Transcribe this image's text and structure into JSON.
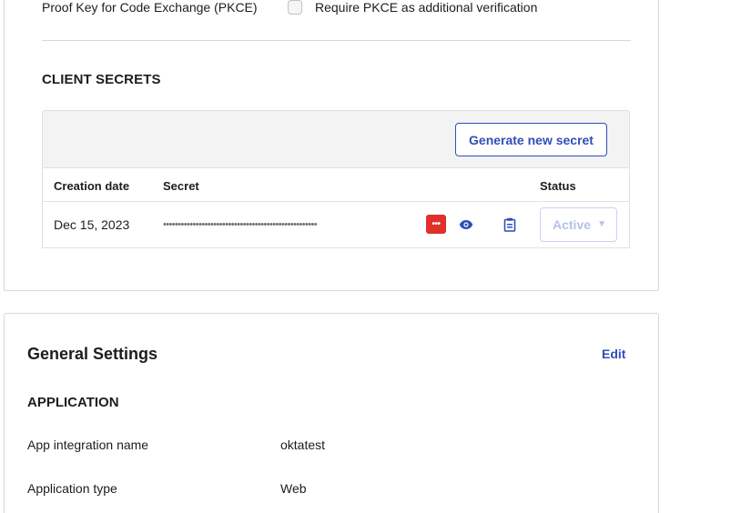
{
  "pkce": {
    "label": "Proof Key for Code Exchange (PKCE)",
    "checkbox_label": "Require PKCE as additional verification",
    "checked": false
  },
  "client_secrets": {
    "heading": "CLIENT SECRETS",
    "generate_button": "Generate new secret",
    "columns": [
      "Creation date",
      "Secret",
      "Status"
    ],
    "rows": [
      {
        "creation_date": "Dec 15, 2023",
        "secret_masked": "••••••••••••••••••••••••••••••••••••••••••••••••••••",
        "password_manager_badge": "•••",
        "status": "Active"
      }
    ],
    "icons": {
      "reveal": "eye-icon",
      "copy": "clipboard-icon",
      "caret": "chevron-down-icon"
    }
  },
  "general_settings": {
    "title": "General Settings",
    "edit_label": "Edit",
    "section_heading": "APPLICATION",
    "fields": [
      {
        "label": "App integration name",
        "value": "oktatest"
      },
      {
        "label": "Application type",
        "value": "Web"
      }
    ]
  },
  "colors": {
    "accent": "#2f4fb6",
    "badge_red": "#e0302a",
    "status_disabled": "#b5c3ea",
    "border": "#d7d7dc"
  }
}
